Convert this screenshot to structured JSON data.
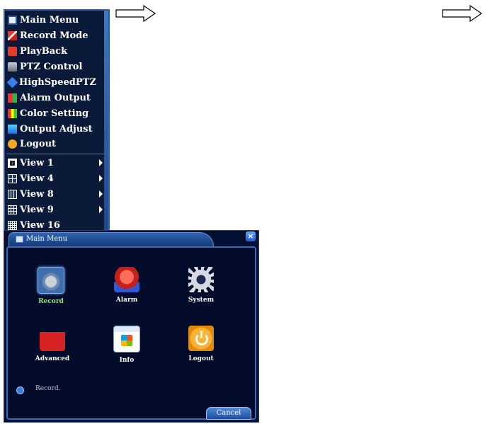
{
  "context_menu": {
    "items": [
      {
        "label": "Main Menu",
        "icon": "main-menu-icon"
      },
      {
        "label": "Record Mode",
        "icon": "record-mode-icon"
      },
      {
        "label": "PlayBack",
        "icon": "playback-icon"
      },
      {
        "label": "PTZ Control",
        "icon": "ptz-icon"
      },
      {
        "label": "HighSpeedPTZ",
        "icon": "highspeed-ptz-icon"
      },
      {
        "label": "Alarm Output",
        "icon": "alarm-output-icon"
      },
      {
        "label": "Color Setting",
        "icon": "color-setting-icon"
      },
      {
        "label": "Output Adjust",
        "icon": "output-adjust-icon"
      },
      {
        "label": "Logout",
        "icon": "logout-icon"
      }
    ],
    "view_items": [
      {
        "label": "View 1",
        "has_submenu": true
      },
      {
        "label": "View 4",
        "has_submenu": true
      },
      {
        "label": "View 8",
        "has_submenu": true
      },
      {
        "label": "View 9",
        "has_submenu": true
      },
      {
        "label": "View 16",
        "has_submenu": false
      }
    ]
  },
  "main_menu_window": {
    "title": "Main Menu",
    "tiles": [
      {
        "label": "Record",
        "selected": true
      },
      {
        "label": "Alarm",
        "selected": false
      },
      {
        "label": "System",
        "selected": false
      },
      {
        "label": "Advanced",
        "selected": false
      },
      {
        "label": "Info",
        "selected": false
      },
      {
        "label": "Logout",
        "selected": false
      }
    ],
    "status": "Record.",
    "cancel_label": "Cancel",
    "close_glyph": "×",
    "colors": {
      "selected_label": "#8fef6a",
      "background": "#041032",
      "accent": "#3d6ab5"
    }
  }
}
